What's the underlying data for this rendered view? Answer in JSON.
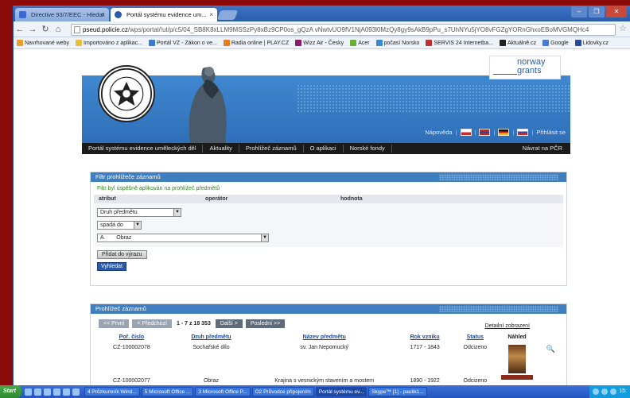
{
  "browser": {
    "tabs": [
      {
        "title": "Directive 93/7/EEC - Hledat",
        "active": false
      },
      {
        "title": "Portál systému evidence um...",
        "active": true
      }
    ],
    "url_host": "pseud.policie.cz",
    "url_path": "/wps/portal/!ut/p/c5/04_SB8K8xLLM9MSSzPy8xBz9CP0os_gQzA vNwtvUO9fV1NjA093l0MzQy8gy9sAkB9pPu_s7UhNYu5jYO8vFGZgYORnGhxoEBoMVGMQHc4",
    "bookmarks": [
      {
        "label": "Navrhované weby",
        "color": "#e8a030"
      },
      {
        "label": "Importováno z aplikac...",
        "color": "#e8c040"
      },
      {
        "label": "Portál VZ - Zákon o ve...",
        "color": "#3a7ad0"
      },
      {
        "label": "Radia online | PLAY.CZ",
        "color": "#e87a20"
      },
      {
        "label": "Wizz Air - Česky",
        "color": "#8a1a6a"
      },
      {
        "label": "Acer",
        "color": "#6ab030"
      },
      {
        "label": "počasí Norsko",
        "color": "#3a8ad0"
      },
      {
        "label": "SERVIS 24 Internetba...",
        "color": "#c03030"
      },
      {
        "label": "Aktuálně.cz",
        "color": "#222222"
      },
      {
        "label": "Google",
        "color": "#4a7ad8"
      },
      {
        "label": "Lidovky.cz",
        "color": "#2a4a9a"
      }
    ]
  },
  "site": {
    "seal_text": "POLICIE ČESKÉ REPUBLIKY",
    "norway_logo": "norway grants",
    "toplinks": {
      "help": "Nápověda",
      "login": "Přihlásit se"
    },
    "nav": [
      "Portál systému evidence uměleckých děl",
      "Aktuality",
      "Prohlížeč záznamů",
      "O aplikaci",
      "Norské fondy"
    ],
    "nav_right": "Návrat na PČR"
  },
  "filter": {
    "title": "Filtr prohlížeče záznamů",
    "message": "Filtr byl úspěšně aplikován na prohlížeč předmětů",
    "headers": {
      "attribute": "atribut",
      "operator": "operátor",
      "value": "hodnota"
    },
    "attribute_select": "Druh předmětu",
    "operator_select": "spadá do",
    "value_prefix": "A",
    "value_select": "Obraz",
    "add_button": "Přidat do výrazu",
    "search_button": "Vyhledat"
  },
  "results": {
    "title": "Prohlížeč záznamů",
    "first": "<< První",
    "prev": "< Předchozí",
    "count": "1 - 7 z 18 353",
    "next": "Další >",
    "last": "Poslední >>",
    "detail_link": "Detailní zobrazení",
    "columns": [
      "Poř. číslo",
      "Druh předmětu",
      "Název předmětu",
      "Rok vzniku",
      "Status",
      "Náhled"
    ],
    "rows": [
      {
        "id": "CZ-100002078",
        "type": "Sochařské dílo",
        "name": "sv. Jan Nepomucký",
        "year": "1717 - 1843",
        "status": "Odcizeno"
      },
      {
        "id": "CZ-100002077",
        "type": "Obraz",
        "name": "Krajina s vesnickým stavením a mostem",
        "year": "1890 - 1922",
        "status": "Odcizeno"
      }
    ]
  },
  "taskbar": {
    "start": "Start",
    "items": [
      "4 Průzkumník Wind...",
      "5 Microsoft Office ...",
      "3 Microsoft Office P...",
      "O2 Průvodce připojením",
      "Portál systému ev...",
      "Skype™ [1] - paulik1..."
    ],
    "clock": "15:"
  }
}
